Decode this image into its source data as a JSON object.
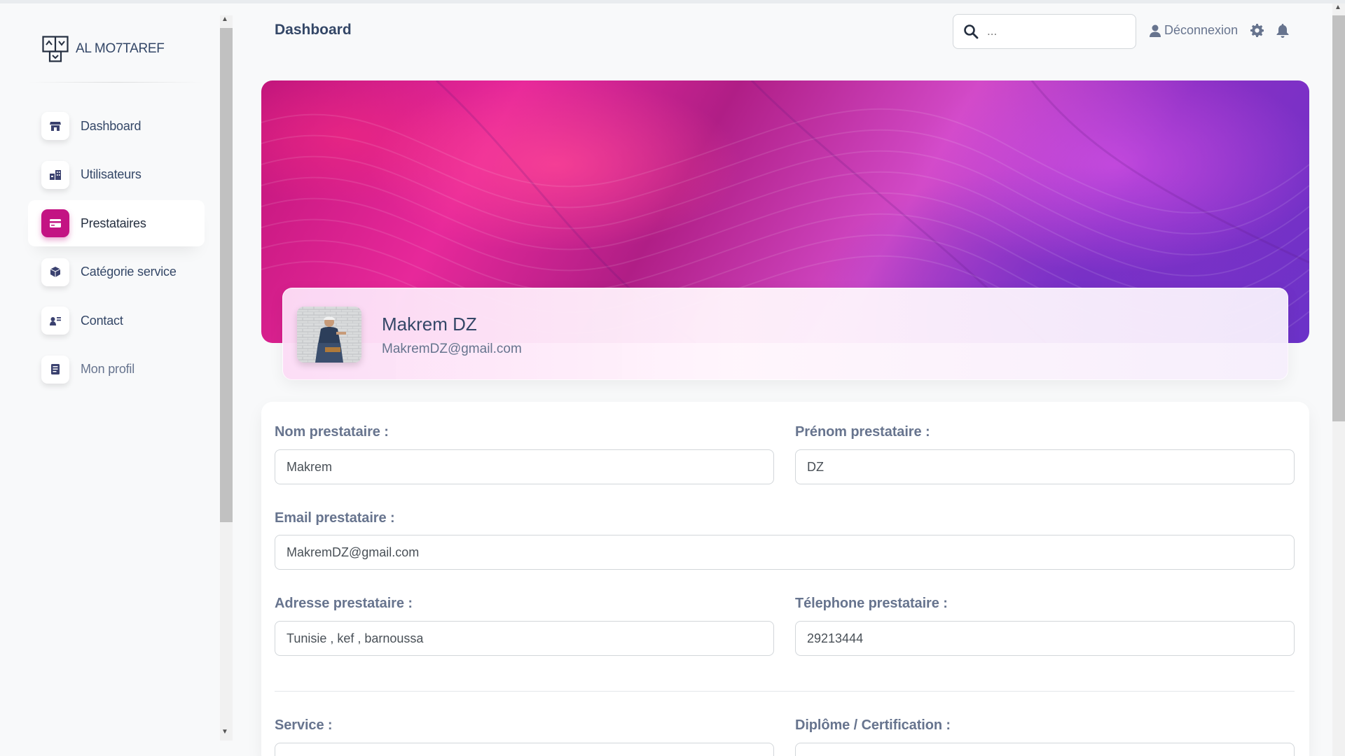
{
  "brand": {
    "name": "AL MO7TAREF"
  },
  "sidebar": {
    "items": [
      {
        "label": "Dashboard",
        "icon": "shop-icon"
      },
      {
        "label": "Utilisateurs",
        "icon": "office-icon"
      },
      {
        "label": "Prestataires",
        "icon": "credit-card-icon",
        "active": true
      },
      {
        "label": "Catégorie service",
        "icon": "box-icon"
      },
      {
        "label": "Contact",
        "icon": "user-contact-icon"
      },
      {
        "label": "Mon profil",
        "icon": "document-icon"
      }
    ]
  },
  "header": {
    "title": "Dashboard",
    "search_placeholder": "...",
    "logout_label": "Déconnexion"
  },
  "profile": {
    "name": "Makrem DZ",
    "email": "MakremDZ@gmail.com"
  },
  "form": {
    "nom_label": "Nom prestataire :",
    "nom_value": "Makrem",
    "prenom_label": "Prénom prestataire :",
    "prenom_value": "DZ",
    "email_label": "Email prestataire :",
    "email_value": "MakremDZ@gmail.com",
    "adresse_label": "Adresse prestataire :",
    "adresse_value": "Tunisie , kef , barnoussa",
    "telephone_label": "Télephone prestataire :",
    "telephone_value": "29213444",
    "service_label": "Service :",
    "diplome_label": "Diplôme / Certification :"
  },
  "colors": {
    "accent": "#c31383",
    "text": "#344767",
    "muted": "#67748e"
  }
}
